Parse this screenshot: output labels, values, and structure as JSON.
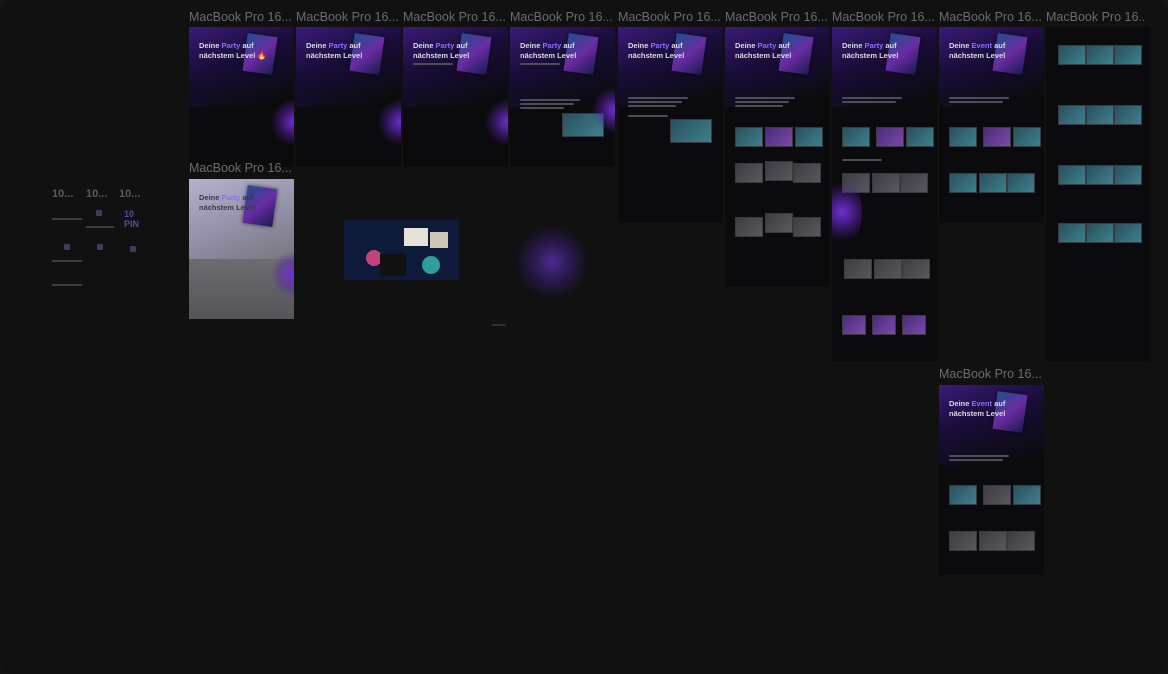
{
  "canvas": {
    "background": "#111112",
    "accent": "#7a52f5"
  },
  "frame_label": "MacBook Pro 16...",
  "hero": {
    "party_line1": "Deine",
    "party_accent": "Party",
    "party_rest": "auf nächstem Level",
    "flame": "🔥",
    "event_word": "Event"
  },
  "mini_panel": {
    "numbers": [
      "10...",
      "10...",
      "10..."
    ],
    "pin": "10 PIN"
  }
}
